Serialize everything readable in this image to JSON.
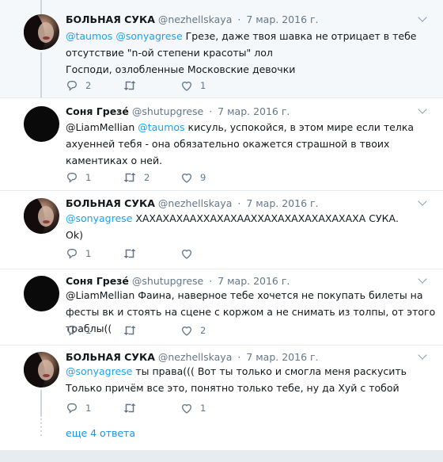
{
  "tweets": [
    {
      "name": "БОЛЬНАЯ СУКА",
      "handle": "@nezhellskaya",
      "time": "7 мар. 2016 г.",
      "text_parts": [
        "@taumos",
        " ",
        "@sonyagrese",
        " Грезе, даже твоя шавка не отрицает в тебе отсутствие \"n-ой степени красоты\" лол"
      ],
      "text_line2": "Господи, озлобленные Московские девочки",
      "replies": "2",
      "retweets": "",
      "likes": "1"
    },
    {
      "name": "Соня Грезé",
      "handle": "@shutupgrese",
      "time": "7 мар. 2016 г.",
      "text_parts": [
        "@LiamMellian",
        " ",
        "@taumos",
        " кисуль, успокойся, в этом мире если телка ахуенней тебя - она обязательно окажется страшной в твоих каментиках о ней."
      ],
      "replies": "1",
      "retweets": "2",
      "likes": "9"
    },
    {
      "name": "БОЛЬНАЯ СУКА",
      "handle": "@nezhellskaya",
      "time": "7 мар. 2016 г.",
      "text_parts": [
        "@sonyagrese",
        " ХАХАХАХААХХАХАХААХХАХАХАХАХАХАХАХА СУКА."
      ],
      "text_line2": "Ok)",
      "replies": "1",
      "retweets": "",
      "likes": ""
    },
    {
      "name": "Соня Грезé",
      "handle": "@shutupgrese",
      "time": "7 мар. 2016 г.",
      "text_parts": [
        "@LiamMellian",
        " Фаина, наверное тебе хочется не покупать билеты на фесты вк и стоять на сцене с коржом а не снимать из толпы, от этого траблы(("
      ],
      "replies": "1",
      "retweets": "",
      "likes": "2"
    },
    {
      "name": "БОЛЬНАЯ СУКА",
      "handle": "@nezhellskaya",
      "time": "7 мар. 2016 г.",
      "text_parts": [
        "@sonyagrese",
        " ты права((( Вот ты только и смогла меня раскусить"
      ],
      "text_line2": "Только причём все это, понятно только тебе, ну да Хуй с тобой",
      "replies": "1",
      "retweets": "",
      "likes": "1"
    }
  ],
  "more_replies": "еще 4 ответа",
  "colors": {
    "accent": "#1da1f2",
    "secondary_text": "#657786",
    "highlight_bg": "#f5f8fa"
  }
}
